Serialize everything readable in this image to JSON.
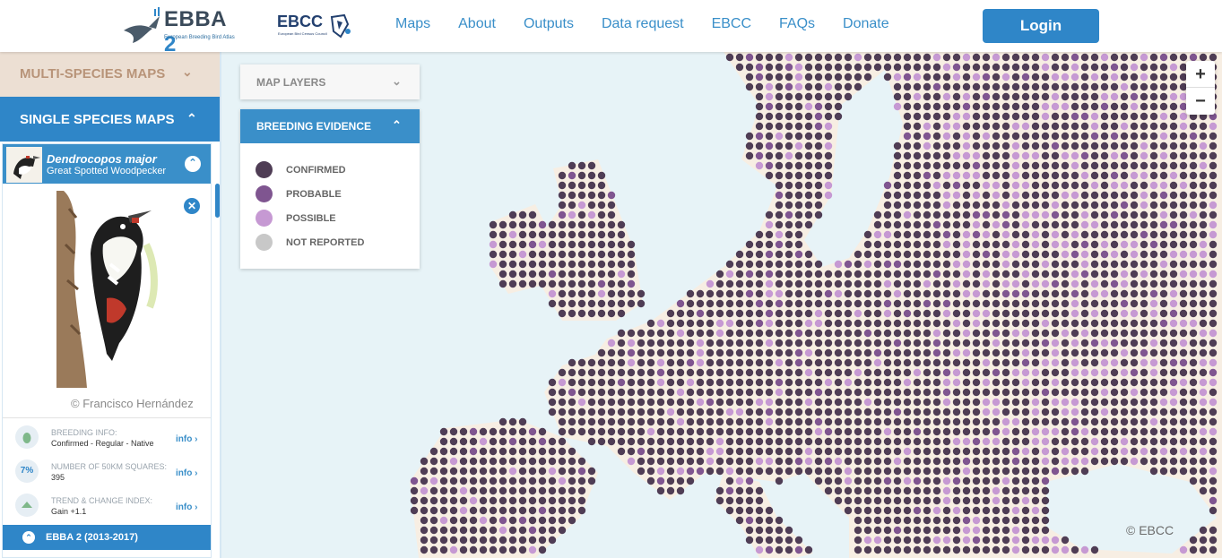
{
  "header": {
    "ebba_logo": {
      "name": "EBBA",
      "num": "2",
      "subtitle": "European Breeding Bird Atlas"
    },
    "ebcc_logo": {
      "name": "EBCC",
      "subtitle": "European Bird Census Council"
    },
    "nav": [
      "Maps",
      "About",
      "Outputs",
      "Data request",
      "EBCC",
      "FAQs",
      "Donate"
    ],
    "login_label": "Login"
  },
  "sidebar": {
    "multi_label": "MULTI-SPECIES MAPS",
    "single_label": "SINGLE SPECIES MAPS",
    "species": {
      "latin": "Dendrocopos major",
      "common": "Great Spotted Woodpecker",
      "credit": "© Francisco Hernández"
    },
    "info": [
      {
        "icon": "egg-icon",
        "label": "BREEDING INFO:",
        "value": "Confirmed - Regular - Native",
        "link": "info ›"
      },
      {
        "badge": "7%",
        "label": "NUMBER OF 50KM SQUARES:",
        "value": "395",
        "link": "info ›"
      },
      {
        "icon": "trend-up-icon",
        "label": "TREND & CHANGE INDEX:",
        "value": "Gain +1.1",
        "link": "info ›"
      }
    ],
    "period_label": "EBBA 2 (2013-2017)"
  },
  "panels": {
    "layers_label": "MAP LAYERS",
    "evidence_label": "BREEDING EVIDENCE",
    "legend": [
      {
        "label": "CONFIRMED",
        "color": "#4f3d55"
      },
      {
        "label": "PROBABLE",
        "color": "#7f5590"
      },
      {
        "label": "POSSIBLE",
        "color": "#c699d3"
      },
      {
        "label": "NOT REPORTED",
        "color": "#c8c8c8"
      }
    ]
  },
  "map": {
    "zoom_in": "+",
    "zoom_out": "−",
    "copyright": "© EBCC",
    "colors": {
      "sea": "#e7f3f7",
      "land": "#f7eee3",
      "confirmed": "#4f3d55",
      "probable": "#7f5590",
      "possible": "#c699d3"
    }
  }
}
